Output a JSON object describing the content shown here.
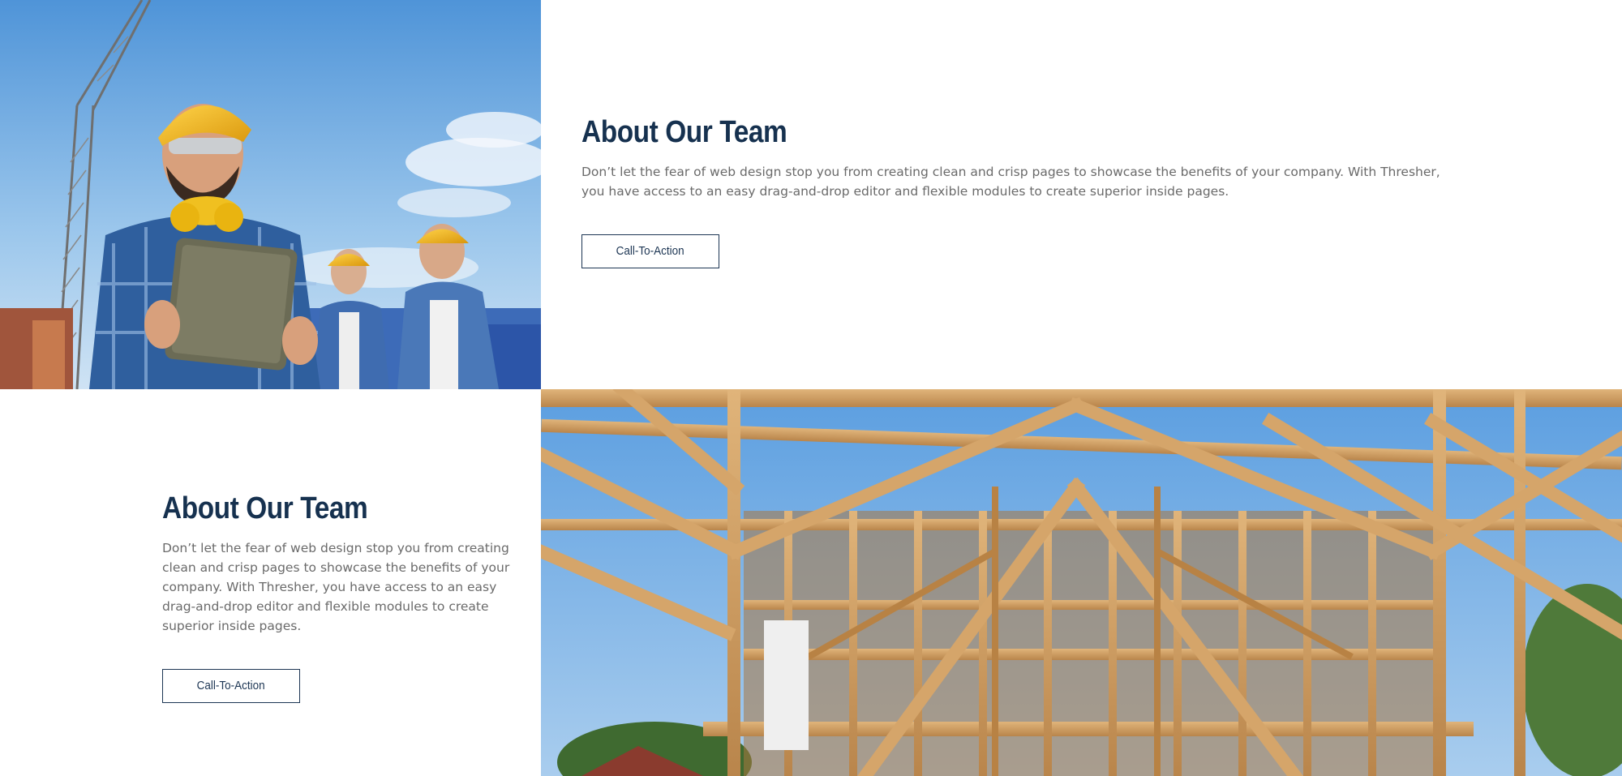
{
  "section_top": {
    "heading": "About Our Team",
    "body": "Don’t let the fear of web design stop you from creating clean and crisp pages to showcase the benefits of your company. With Thresher, you have access to an easy drag-and-drop editor and flexible modules to create superior inside pages.",
    "cta_label": "Call-To-Action"
  },
  "section_bottom": {
    "heading": "About Our Team",
    "body": "Don’t let the fear of web design stop you from creating clean and crisp pages to showcase the benefits of your company. With Thresher, you have access to an easy drag-and-drop editor and flexible modules to create superior inside pages.",
    "cta_label": "Call-To-Action"
  },
  "colors": {
    "heading": "#16314f",
    "body_text": "#6a6a6a",
    "button_border": "#1c3553",
    "sky": "#8fbde6",
    "hardhat": "#f2b51c",
    "timber": "#c9995c"
  }
}
